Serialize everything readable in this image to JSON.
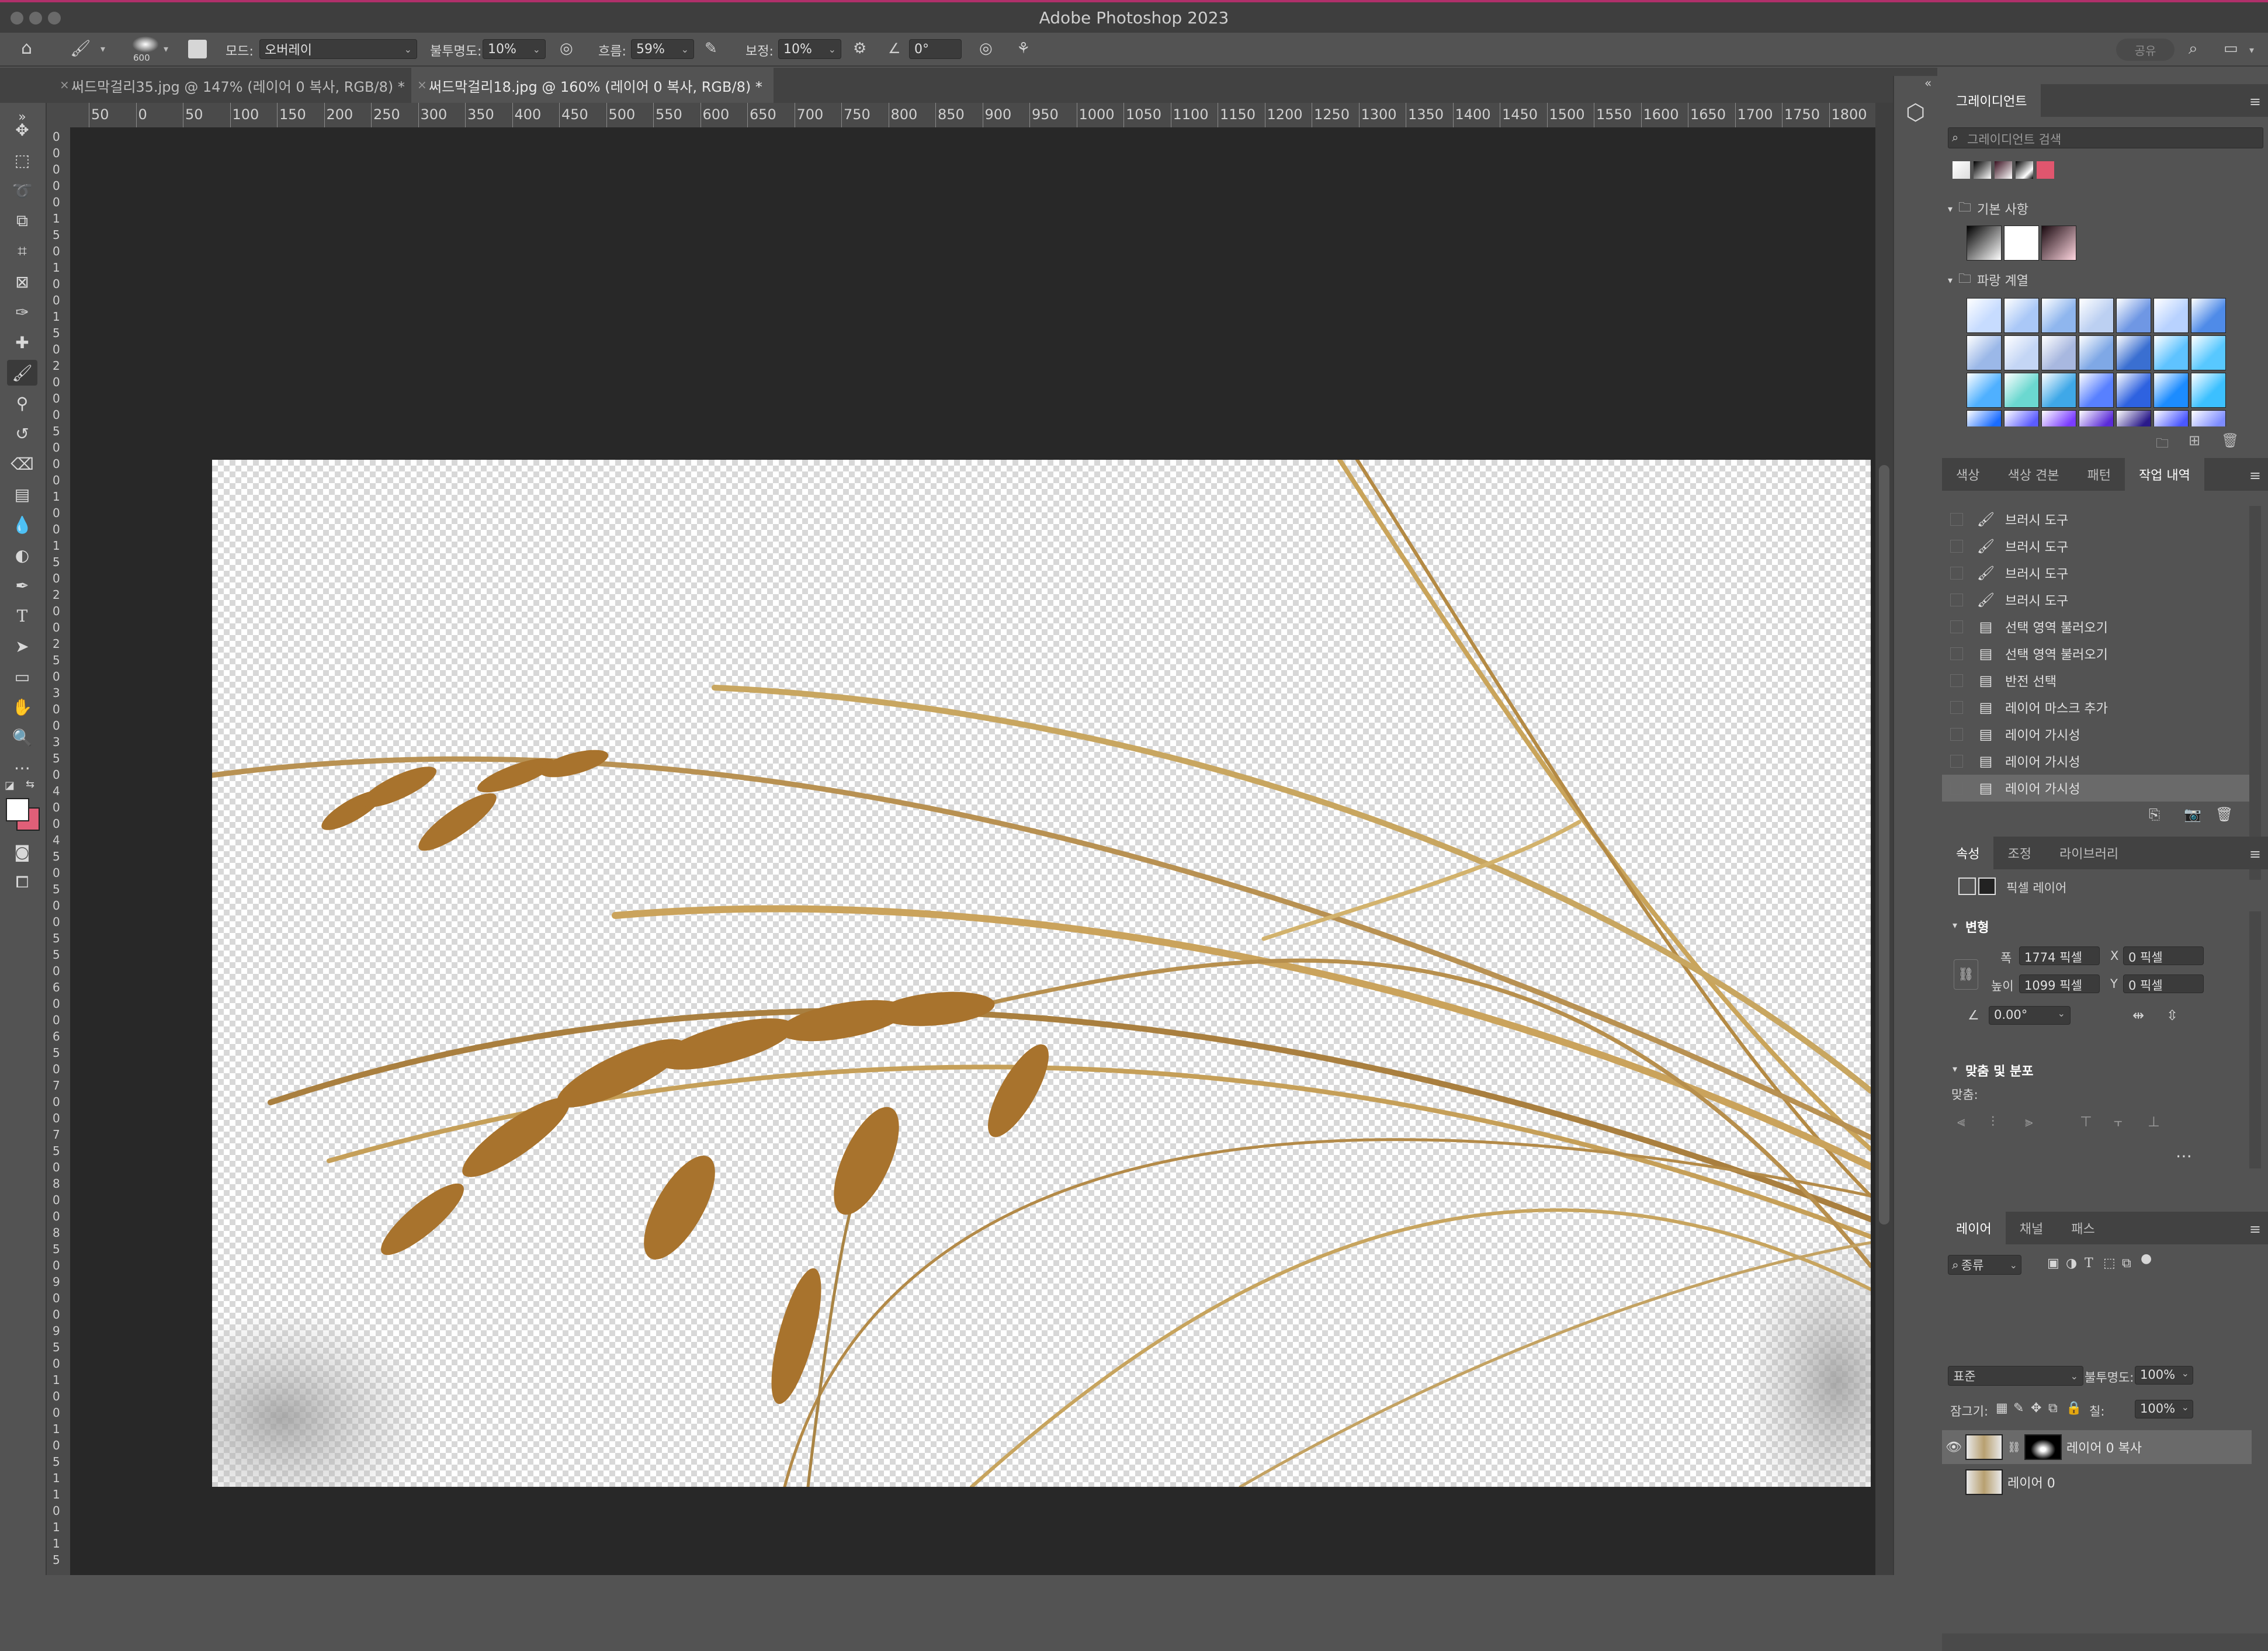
{
  "window": {
    "title": "Adobe Photoshop 2023"
  },
  "options": {
    "brush_size": "600",
    "mode_label": "모드:",
    "mode_value": "오버레이",
    "opacity_label": "불투명도:",
    "opacity_value": "10%",
    "flow_label": "흐름:",
    "flow_value": "59%",
    "smoothing_label": "보정:",
    "smoothing_value": "10%",
    "angle_value": "0°",
    "share_label": "공유"
  },
  "tabs": [
    {
      "label": "써드막걸리35.jpg @ 147% (레이어 0 복사, RGB/8) *"
    },
    {
      "label": "써드막걸리18.jpg @ 160% (레이어 0 복사, RGB/8) *"
    }
  ],
  "ruler": {
    "top": [
      "50",
      "0",
      "50",
      "100",
      "150",
      "200",
      "250",
      "300",
      "350",
      "400",
      "450",
      "500",
      "550",
      "600",
      "650",
      "700",
      "750",
      "800",
      "850",
      "900",
      "950",
      "1000",
      "1050",
      "1100",
      "1150",
      "1200",
      "1250",
      "1300",
      "1350",
      "1400",
      "1450",
      "1500",
      "1550",
      "1600",
      "1650",
      "1700",
      "1750",
      "1800"
    ],
    "left": [
      "0",
      "0",
      "0",
      "0",
      "0",
      "1",
      "5",
      "0",
      "1",
      "0",
      "0",
      "1",
      "5",
      "0",
      "2",
      "0",
      "0",
      "0",
      "5",
      "0",
      "0",
      "0",
      "1",
      "0",
      "0",
      "1",
      "5",
      "0",
      "2",
      "0",
      "0",
      "2",
      "5",
      "0",
      "3",
      "0",
      "0",
      "3",
      "5",
      "0",
      "4",
      "0",
      "0",
      "4",
      "5",
      "0",
      "5",
      "0",
      "0",
      "5",
      "5",
      "0",
      "6",
      "0",
      "0",
      "6",
      "5",
      "0",
      "7",
      "0",
      "0",
      "7",
      "5",
      "0",
      "8",
      "0",
      "0",
      "8",
      "5",
      "0",
      "9",
      "0",
      "0",
      "9",
      "5",
      "0",
      "1",
      "0",
      "0",
      "1",
      "0",
      "5",
      "1",
      "1",
      "0",
      "1",
      "1",
      "5"
    ]
  },
  "gradients_panel": {
    "title": "그레이디언트",
    "search_placeholder": "그레이디언트 검색",
    "groups": [
      {
        "name": "기본 사항"
      },
      {
        "name": "파랑 계열"
      }
    ]
  },
  "history_panel": {
    "tabs": [
      "색상",
      "색상 견본",
      "패턴",
      "작업 내역"
    ],
    "items": [
      {
        "label": "브러시 도구",
        "icon": "brush-icon"
      },
      {
        "label": "브러시 도구",
        "icon": "brush-icon"
      },
      {
        "label": "브러시 도구",
        "icon": "brush-icon"
      },
      {
        "label": "브러시 도구",
        "icon": "brush-icon"
      },
      {
        "label": "선택 영역 불러오기",
        "icon": "document-icon"
      },
      {
        "label": "선택 영역 불러오기",
        "icon": "document-icon"
      },
      {
        "label": "반전 선택",
        "icon": "document-icon"
      },
      {
        "label": "레이어 마스크 추가",
        "icon": "document-icon"
      },
      {
        "label": "레이어 가시성",
        "icon": "document-icon"
      },
      {
        "label": "레이어 가시성",
        "icon": "document-icon"
      },
      {
        "label": "레이어 가시성",
        "icon": "document-icon"
      }
    ]
  },
  "properties_panel": {
    "tabs": [
      "속성",
      "조정",
      "라이브러리"
    ],
    "type_label": "픽셀 레이어",
    "transform_title": "변형",
    "width_label": "폭",
    "width_value": "1774 픽셀",
    "height_label": "높이",
    "height_value": "1099 픽셀",
    "x_label": "X",
    "x_value": "0 픽셀",
    "y_label": "Y",
    "y_value": "0 픽셀",
    "angle_value": "0.00°",
    "align_title": "맞춤 및 분포",
    "align_label": "맞춤:"
  },
  "layers_panel": {
    "tabs": [
      "레이어",
      "채널",
      "패스"
    ],
    "filter_label": "종류",
    "blend_mode": "표준",
    "opacity_label": "불투명도:",
    "opacity_value": "100%",
    "lock_label": "잠그기:",
    "fill_label": "칠:",
    "fill_value": "100%",
    "layers": [
      {
        "name": "레이어 0 복사",
        "visible": true,
        "selected": true
      },
      {
        "name": "레이어 0",
        "visible": false,
        "selected": false
      }
    ]
  },
  "colors": {
    "accent_bar": "#b0306a",
    "foreground": "#ffffff",
    "background": "#e05f78"
  }
}
